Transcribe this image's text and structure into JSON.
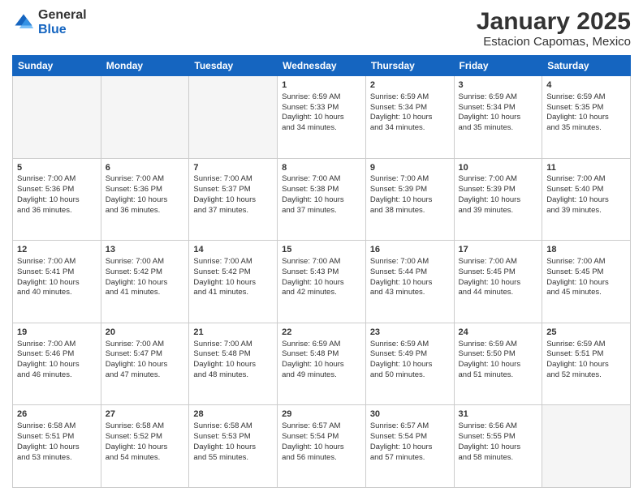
{
  "header": {
    "logo_general": "General",
    "logo_blue": "Blue",
    "month_title": "January 2025",
    "location": "Estacion Capomas, Mexico"
  },
  "weekdays": [
    "Sunday",
    "Monday",
    "Tuesday",
    "Wednesday",
    "Thursday",
    "Friday",
    "Saturday"
  ],
  "rows": [
    [
      {
        "day": "",
        "lines": []
      },
      {
        "day": "",
        "lines": []
      },
      {
        "day": "",
        "lines": []
      },
      {
        "day": "1",
        "lines": [
          "Sunrise: 6:59 AM",
          "Sunset: 5:33 PM",
          "Daylight: 10 hours",
          "and 34 minutes."
        ]
      },
      {
        "day": "2",
        "lines": [
          "Sunrise: 6:59 AM",
          "Sunset: 5:34 PM",
          "Daylight: 10 hours",
          "and 34 minutes."
        ]
      },
      {
        "day": "3",
        "lines": [
          "Sunrise: 6:59 AM",
          "Sunset: 5:34 PM",
          "Daylight: 10 hours",
          "and 35 minutes."
        ]
      },
      {
        "day": "4",
        "lines": [
          "Sunrise: 6:59 AM",
          "Sunset: 5:35 PM",
          "Daylight: 10 hours",
          "and 35 minutes."
        ]
      }
    ],
    [
      {
        "day": "5",
        "lines": [
          "Sunrise: 7:00 AM",
          "Sunset: 5:36 PM",
          "Daylight: 10 hours",
          "and 36 minutes."
        ]
      },
      {
        "day": "6",
        "lines": [
          "Sunrise: 7:00 AM",
          "Sunset: 5:36 PM",
          "Daylight: 10 hours",
          "and 36 minutes."
        ]
      },
      {
        "day": "7",
        "lines": [
          "Sunrise: 7:00 AM",
          "Sunset: 5:37 PM",
          "Daylight: 10 hours",
          "and 37 minutes."
        ]
      },
      {
        "day": "8",
        "lines": [
          "Sunrise: 7:00 AM",
          "Sunset: 5:38 PM",
          "Daylight: 10 hours",
          "and 37 minutes."
        ]
      },
      {
        "day": "9",
        "lines": [
          "Sunrise: 7:00 AM",
          "Sunset: 5:39 PM",
          "Daylight: 10 hours",
          "and 38 minutes."
        ]
      },
      {
        "day": "10",
        "lines": [
          "Sunrise: 7:00 AM",
          "Sunset: 5:39 PM",
          "Daylight: 10 hours",
          "and 39 minutes."
        ]
      },
      {
        "day": "11",
        "lines": [
          "Sunrise: 7:00 AM",
          "Sunset: 5:40 PM",
          "Daylight: 10 hours",
          "and 39 minutes."
        ]
      }
    ],
    [
      {
        "day": "12",
        "lines": [
          "Sunrise: 7:00 AM",
          "Sunset: 5:41 PM",
          "Daylight: 10 hours",
          "and 40 minutes."
        ]
      },
      {
        "day": "13",
        "lines": [
          "Sunrise: 7:00 AM",
          "Sunset: 5:42 PM",
          "Daylight: 10 hours",
          "and 41 minutes."
        ]
      },
      {
        "day": "14",
        "lines": [
          "Sunrise: 7:00 AM",
          "Sunset: 5:42 PM",
          "Daylight: 10 hours",
          "and 41 minutes."
        ]
      },
      {
        "day": "15",
        "lines": [
          "Sunrise: 7:00 AM",
          "Sunset: 5:43 PM",
          "Daylight: 10 hours",
          "and 42 minutes."
        ]
      },
      {
        "day": "16",
        "lines": [
          "Sunrise: 7:00 AM",
          "Sunset: 5:44 PM",
          "Daylight: 10 hours",
          "and 43 minutes."
        ]
      },
      {
        "day": "17",
        "lines": [
          "Sunrise: 7:00 AM",
          "Sunset: 5:45 PM",
          "Daylight: 10 hours",
          "and 44 minutes."
        ]
      },
      {
        "day": "18",
        "lines": [
          "Sunrise: 7:00 AM",
          "Sunset: 5:45 PM",
          "Daylight: 10 hours",
          "and 45 minutes."
        ]
      }
    ],
    [
      {
        "day": "19",
        "lines": [
          "Sunrise: 7:00 AM",
          "Sunset: 5:46 PM",
          "Daylight: 10 hours",
          "and 46 minutes."
        ]
      },
      {
        "day": "20",
        "lines": [
          "Sunrise: 7:00 AM",
          "Sunset: 5:47 PM",
          "Daylight: 10 hours",
          "and 47 minutes."
        ]
      },
      {
        "day": "21",
        "lines": [
          "Sunrise: 7:00 AM",
          "Sunset: 5:48 PM",
          "Daylight: 10 hours",
          "and 48 minutes."
        ]
      },
      {
        "day": "22",
        "lines": [
          "Sunrise: 6:59 AM",
          "Sunset: 5:48 PM",
          "Daylight: 10 hours",
          "and 49 minutes."
        ]
      },
      {
        "day": "23",
        "lines": [
          "Sunrise: 6:59 AM",
          "Sunset: 5:49 PM",
          "Daylight: 10 hours",
          "and 50 minutes."
        ]
      },
      {
        "day": "24",
        "lines": [
          "Sunrise: 6:59 AM",
          "Sunset: 5:50 PM",
          "Daylight: 10 hours",
          "and 51 minutes."
        ]
      },
      {
        "day": "25",
        "lines": [
          "Sunrise: 6:59 AM",
          "Sunset: 5:51 PM",
          "Daylight: 10 hours",
          "and 52 minutes."
        ]
      }
    ],
    [
      {
        "day": "26",
        "lines": [
          "Sunrise: 6:58 AM",
          "Sunset: 5:51 PM",
          "Daylight: 10 hours",
          "and 53 minutes."
        ]
      },
      {
        "day": "27",
        "lines": [
          "Sunrise: 6:58 AM",
          "Sunset: 5:52 PM",
          "Daylight: 10 hours",
          "and 54 minutes."
        ]
      },
      {
        "day": "28",
        "lines": [
          "Sunrise: 6:58 AM",
          "Sunset: 5:53 PM",
          "Daylight: 10 hours",
          "and 55 minutes."
        ]
      },
      {
        "day": "29",
        "lines": [
          "Sunrise: 6:57 AM",
          "Sunset: 5:54 PM",
          "Daylight: 10 hours",
          "and 56 minutes."
        ]
      },
      {
        "day": "30",
        "lines": [
          "Sunrise: 6:57 AM",
          "Sunset: 5:54 PM",
          "Daylight: 10 hours",
          "and 57 minutes."
        ]
      },
      {
        "day": "31",
        "lines": [
          "Sunrise: 6:56 AM",
          "Sunset: 5:55 PM",
          "Daylight: 10 hours",
          "and 58 minutes."
        ]
      },
      {
        "day": "",
        "lines": []
      }
    ]
  ]
}
